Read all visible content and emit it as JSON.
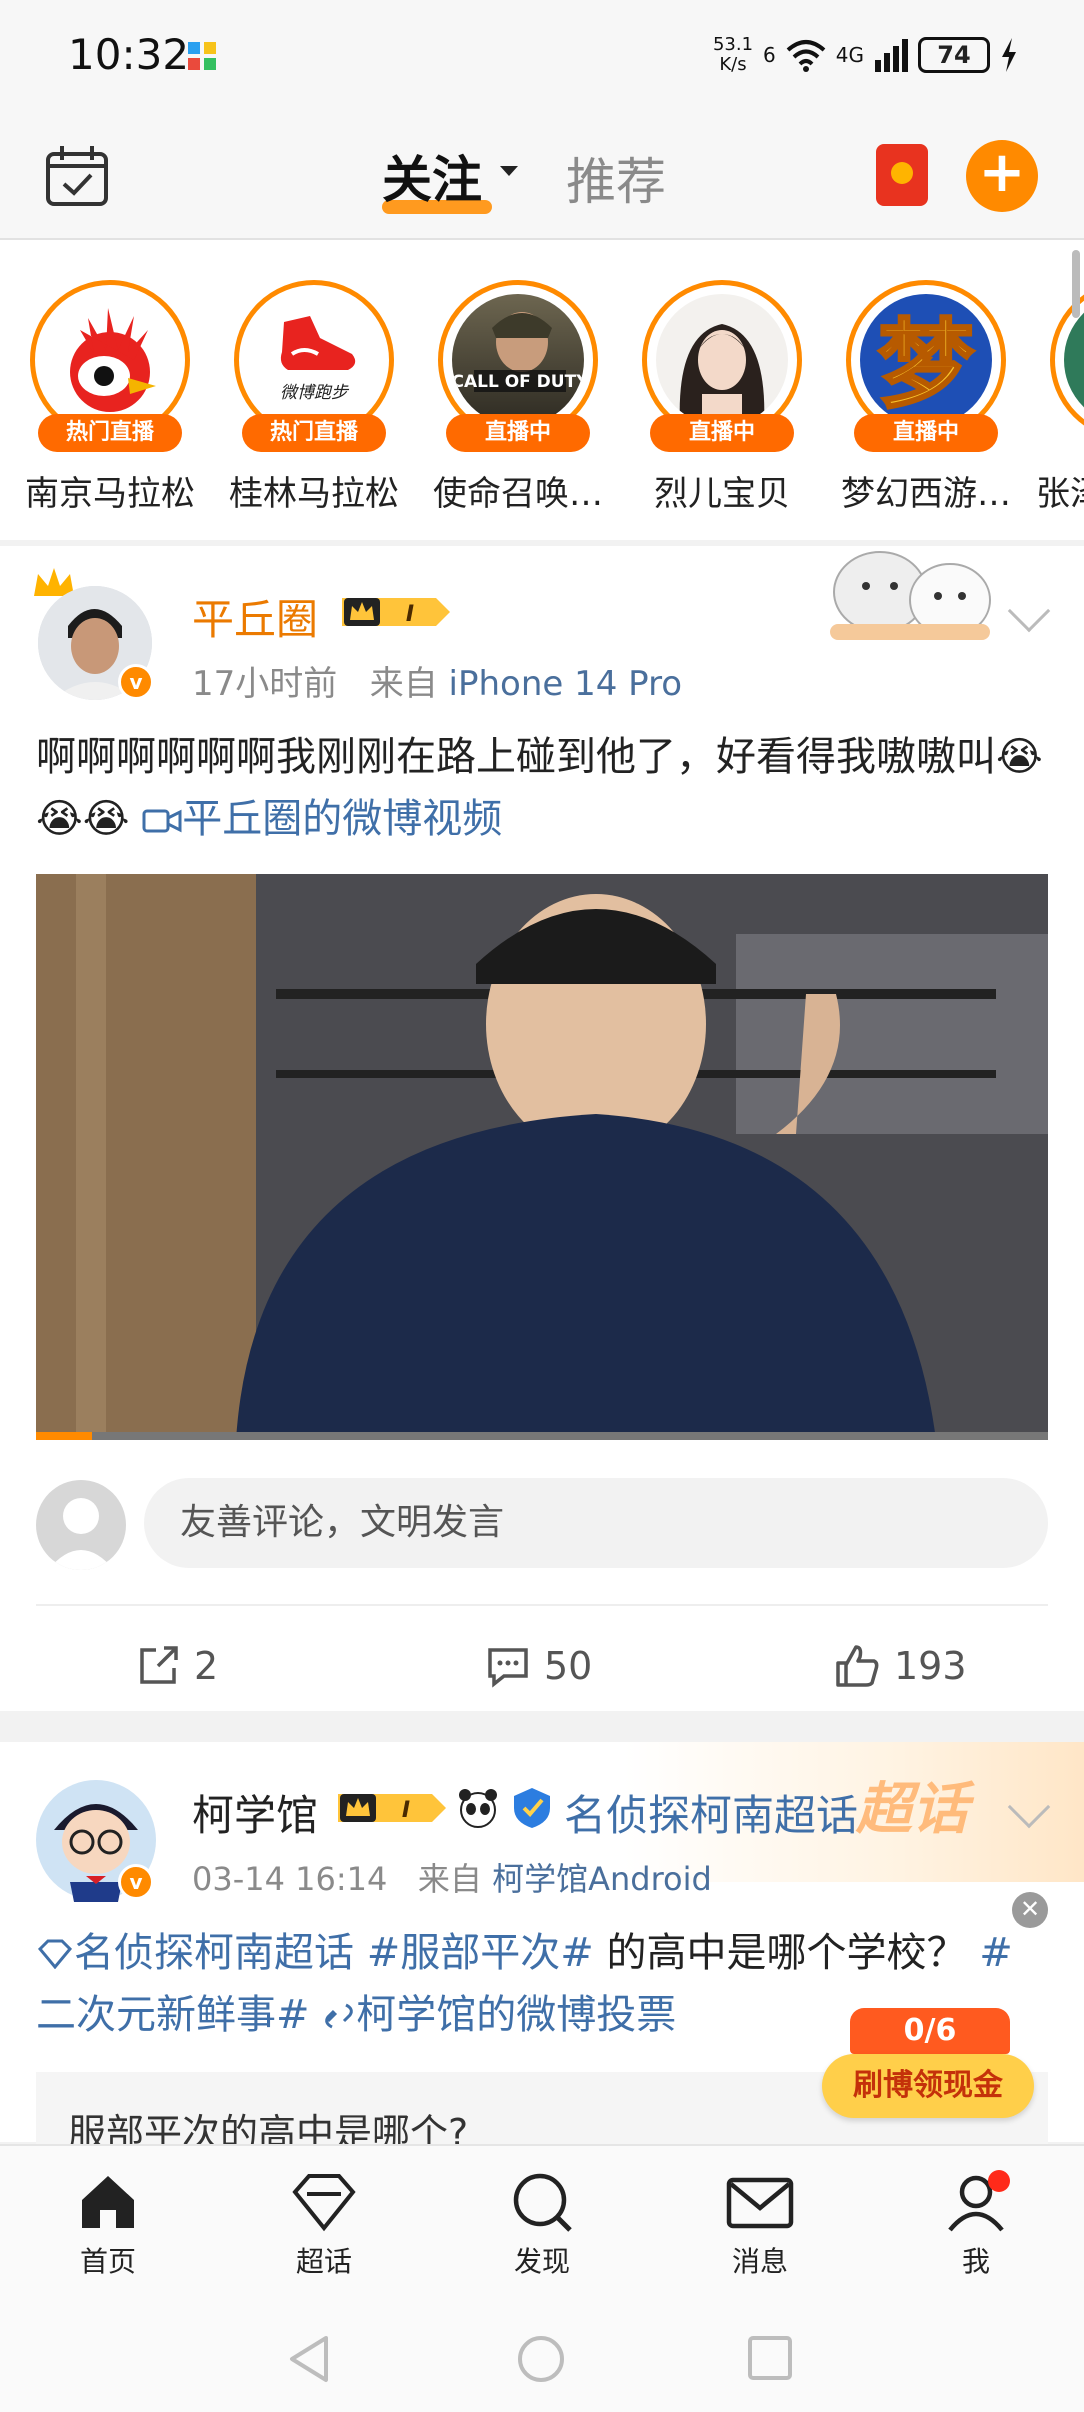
{
  "status_bar": {
    "time": "10:32",
    "speed_value": "53.1",
    "speed_unit": "K/s",
    "network": "4G",
    "signal_superscript": "6",
    "battery": "74"
  },
  "top_nav": {
    "active_tab": "关注",
    "other_tab": "推荐"
  },
  "live_strip": {
    "items": [
      {
        "name": "南京马拉松",
        "badge": "热门直播"
      },
      {
        "name": "桂林马拉松",
        "badge": "热门直播"
      },
      {
        "name": "使命召唤…",
        "badge": "直播中"
      },
      {
        "name": "烈儿宝贝",
        "badge": "直播中"
      },
      {
        "name": "梦幻西游…",
        "badge": "直播中"
      },
      {
        "name": "张泽",
        "badge": ""
      }
    ],
    "logo_text_1": "微博跑步",
    "logo_text_2": "CALL OF DUTY",
    "logo_text_3": "梦"
  },
  "post1": {
    "username": "平丘圈",
    "vip_level": "I",
    "time": "17小时前",
    "source_prefix": "来自",
    "source": "iPhone 14 Pro",
    "text": "啊啊啊啊啊啊我刚刚在路上碰到他了，好看得我嗷嗷叫",
    "emoji": "😭😭😭",
    "video_link": "平丘圈的微博视频",
    "video_progress": 0.055,
    "comment_placeholder": "友善评论，文明发言",
    "reposts": "2",
    "comments": "50",
    "likes": "193"
  },
  "post2": {
    "username": "柯学馆",
    "vip_level": "I",
    "supertopic_tag": "名侦探柯南超话",
    "banner_word": "超话",
    "time": "03-14 16:14",
    "source_prefix": "来自",
    "source": "柯学馆Android",
    "text_topic": "名侦探柯南超话",
    "text_hashtag1": "#服部平次#",
    "text_mid": " 的高中是哪个学校？",
    "text_hashtag2": "#二次元新鲜事#",
    "text_poll_link": "柯学馆的微博投票",
    "poll_question": "服部平次的高中是哪个?"
  },
  "reward": {
    "count": "0/6",
    "label": "刷博领现金"
  },
  "tab_bar": {
    "items": [
      {
        "label": "首页"
      },
      {
        "label": "超话"
      },
      {
        "label": "发现"
      },
      {
        "label": "消息"
      },
      {
        "label": "我"
      }
    ]
  },
  "colors": {
    "accent": "#ff8a00",
    "link": "#3f6fa8",
    "username_vip": "#eb7a00"
  }
}
